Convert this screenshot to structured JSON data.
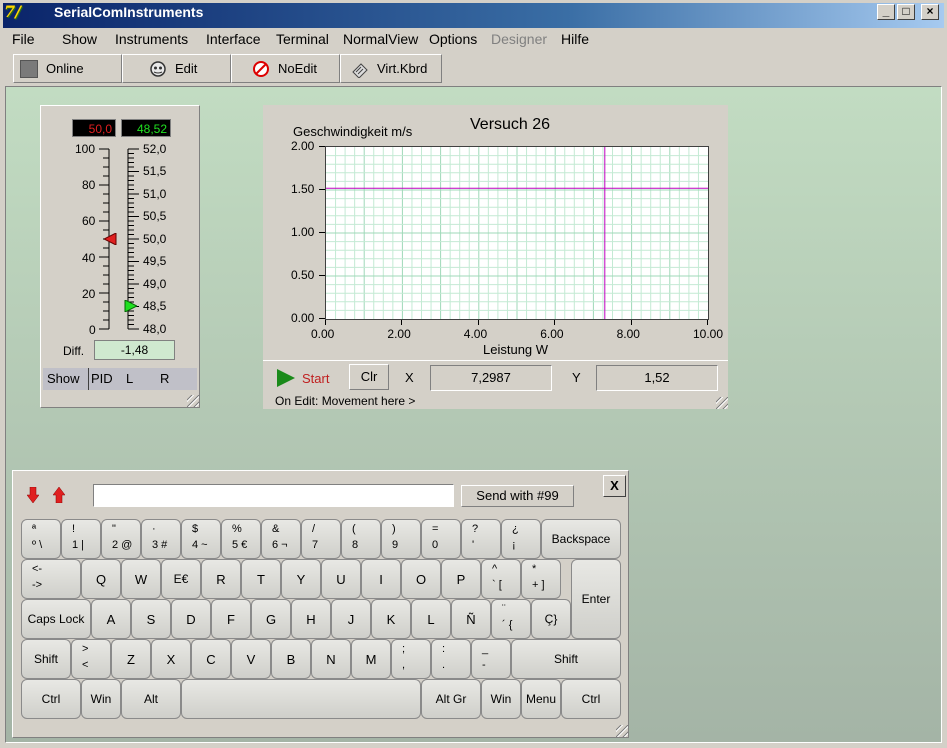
{
  "window": {
    "title": "SerialComInstruments",
    "min": "_",
    "max": "□",
    "close": "×"
  },
  "menu": [
    "File",
    "Show",
    "Instruments",
    "Interface",
    "Terminal",
    "NormalView",
    "Options",
    "Designer",
    "Hilfe"
  ],
  "toolbar": {
    "online": "Online",
    "edit": "Edit",
    "noedit": "NoEdit",
    "vkbd": "Virt.Kbrd"
  },
  "gauge": {
    "lcd_left": "50,0",
    "lcd_right": "48,52",
    "left_scale": [
      "100",
      "80",
      "60",
      "40",
      "20",
      "0"
    ],
    "right_scale": [
      "52,0",
      "51,5",
      "51,0",
      "50,5",
      "50,0",
      "49,5",
      "49,0",
      "48,5",
      "48,0"
    ],
    "diff_label": "Diff.",
    "diff_value": "-1,48",
    "tabs": [
      "Show",
      "PID",
      "L",
      "R"
    ],
    "left_marker_value": 50,
    "right_marker_value": 48.52
  },
  "chart_data": {
    "type": "line",
    "title": "Versuch 26",
    "xlabel": "Leistung W",
    "ylabel": "Geschwindigkeit m/s",
    "x_ticks": [
      "0.00",
      "2.00",
      "4.00",
      "6.00",
      "8.00",
      "10.00"
    ],
    "y_ticks": [
      "0.00",
      "0.50",
      "1.00",
      "1.50",
      "2.00"
    ],
    "xlim": [
      0,
      10
    ],
    "ylim": [
      0,
      2
    ],
    "grid": true,
    "cursor": {
      "x": 7.2987,
      "y": 1.52
    }
  },
  "chart_controls": {
    "start": "Start",
    "clr": "Clr",
    "x_label": "X",
    "x_value": "7,2987",
    "y_label": "Y",
    "y_value": "1,52",
    "status": "On Edit:  Movement here >"
  },
  "keyboard": {
    "close": "X",
    "send_label": "Send with #99",
    "input_value": "",
    "rows": [
      [
        {
          "t": "ª",
          "b": "º \\"
        },
        {
          "t": "!",
          "b": "1 |"
        },
        {
          "t": "\"",
          "b": "2 @"
        },
        {
          "t": "·",
          "b": "3 #"
        },
        {
          "t": "$",
          "b": "4 ~"
        },
        {
          "t": "%",
          "b": "5 €"
        },
        {
          "t": "&",
          "b": "6 ¬"
        },
        {
          "t": "/",
          "b": "7"
        },
        {
          "t": "(",
          "b": "8"
        },
        {
          "t": ")",
          "b": "9"
        },
        {
          "t": "=",
          "b": "0"
        },
        {
          "t": "?",
          "b": "'"
        },
        {
          "t": "¿",
          "b": "¡"
        },
        {
          "c": "Backspace"
        }
      ],
      [
        {
          "t": "<-",
          "b": "->"
        },
        {
          "c": "Q"
        },
        {
          "c": "W"
        },
        {
          "c": "E€"
        },
        {
          "c": "R"
        },
        {
          "c": "T"
        },
        {
          "c": "Y"
        },
        {
          "c": "U"
        },
        {
          "c": "I"
        },
        {
          "c": "O"
        },
        {
          "c": "P"
        },
        {
          "t": "^",
          "b": "` ["
        },
        {
          "t": "*",
          "b": "+ ]"
        },
        {
          "c": "Enter"
        }
      ],
      [
        {
          "c": "Caps Lock"
        },
        {
          "c": "A"
        },
        {
          "c": "S"
        },
        {
          "c": "D"
        },
        {
          "c": "F"
        },
        {
          "c": "G"
        },
        {
          "c": "H"
        },
        {
          "c": "J"
        },
        {
          "c": "K"
        },
        {
          "c": "L"
        },
        {
          "c": "Ñ"
        },
        {
          "t": "¨",
          "b": "´ {"
        },
        {
          "c": "Ç}"
        }
      ],
      [
        {
          "c": "Shift"
        },
        {
          "t": ">",
          "b": "<"
        },
        {
          "c": "Z"
        },
        {
          "c": "X"
        },
        {
          "c": "C"
        },
        {
          "c": "V"
        },
        {
          "c": "B"
        },
        {
          "c": "N"
        },
        {
          "c": "M"
        },
        {
          "t": ";",
          "b": ","
        },
        {
          "t": ":",
          "b": "."
        },
        {
          "t": "_",
          "b": "-"
        },
        {
          "c": "Shift"
        }
      ],
      [
        {
          "c": "Ctrl"
        },
        {
          "c": "Win"
        },
        {
          "c": "Alt"
        },
        {
          "c": ""
        },
        {
          "c": "Alt Gr"
        },
        {
          "c": "Win"
        },
        {
          "c": "Menu"
        },
        {
          "c": "Ctrl"
        }
      ]
    ]
  }
}
